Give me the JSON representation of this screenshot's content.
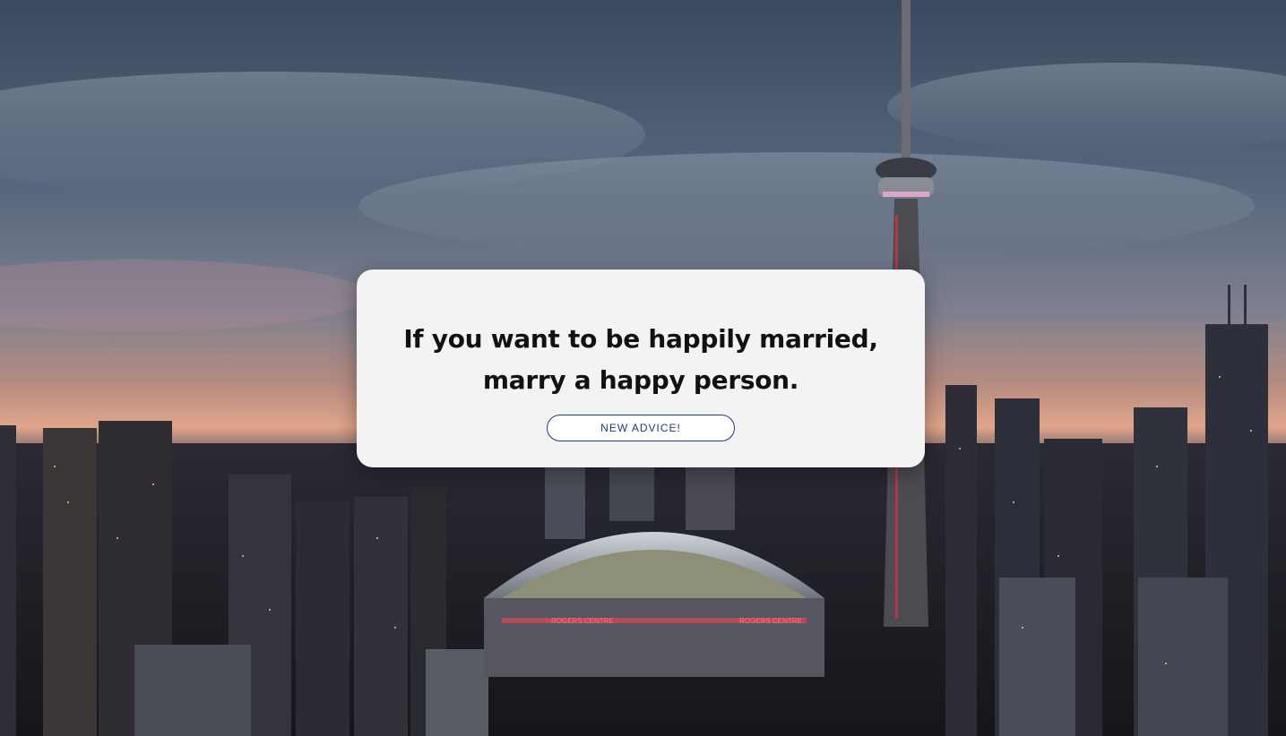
{
  "background": {
    "image": "city-skyline-with-tower-and-dome-stadium",
    "signs": [
      "ROGERS CENTRE",
      "ROGERS CENTRE"
    ]
  },
  "advice_card": {
    "quote": "If you want to be happily married, marry a happy person.",
    "button_label": "NEW ADVICE!"
  },
  "colors": {
    "card_bg": "#f3f3f3",
    "button_accent": "#1f3b7a",
    "quote_text": "#111111"
  }
}
